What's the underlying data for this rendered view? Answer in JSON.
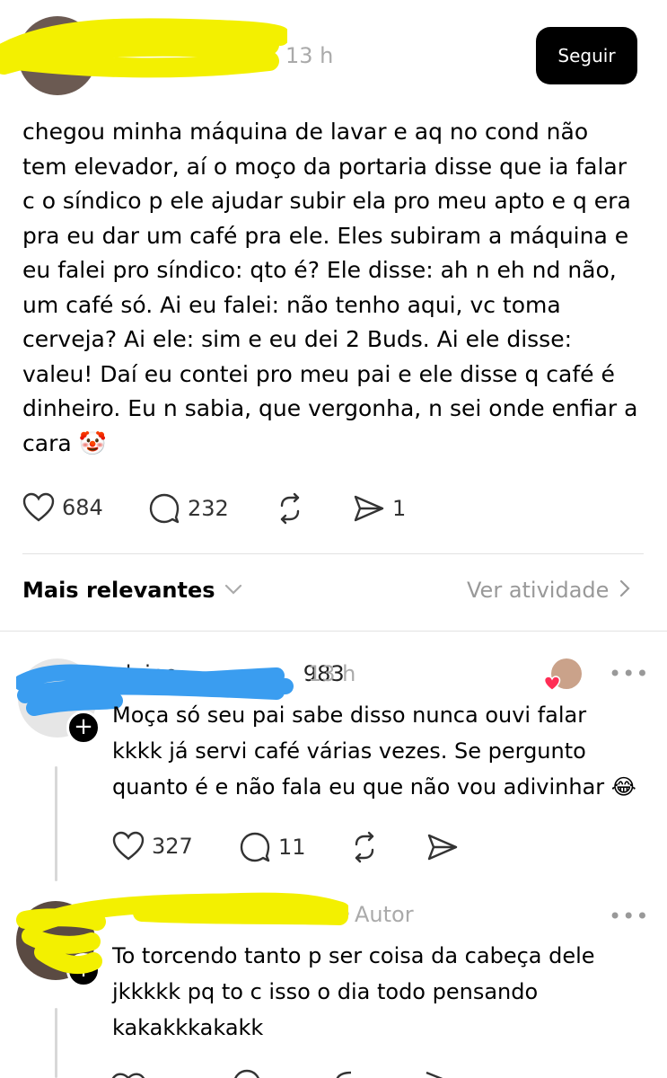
{
  "post": {
    "time": "13 h",
    "follow_label": "Seguir",
    "text": "chegou minha máquina de lavar e aq no cond não\ntem elevador, aí o moço da portaria disse que ia falar\nc o síndico p ele ajudar subir ela pro meu apto e q era\npra eu dar um café pra ele. Eles subiram a máquina e\neu falei pro síndico: qto é? Ele disse: ah n eh nd não,\num café só. Ai eu falei: não tenho aqui, vc toma\ncerveja? Ai ele: sim e eu dei 2 Buds. Ai ele disse:\nvaleu! Daí eu contei pro meu pai e ele disse q café é\ndinheiro. Eu n sabia, que vergonha, n sei onde enfiar a\ncara 🤡",
    "likes": "684",
    "comments": "232",
    "shares": "1"
  },
  "replies_header": {
    "sort_label": "Mais relevantes",
    "activity_label": "Ver atividade"
  },
  "replies": [
    {
      "username": "elaine",
      "username_suffix": "983",
      "time": "13 h",
      "text": "Moça só seu pai sabe disso nunca ouvi falar\nkkkk já servi café várias vezes. Se pergunto\nquanto é e não fala eu que não vou adivinhar 😂",
      "likes": "327",
      "comments": "11"
    },
    {
      "author_label": "Autor",
      "text": "To torcendo tanto p ser coisa da cabeça dele\njkkkkk pq to c isso o dia todo pensando\nkakakkkakakk"
    }
  ],
  "icons": {
    "like": "heart-icon",
    "comment": "comment-icon",
    "repost": "repost-icon",
    "share": "share-icon",
    "more": "more-icon",
    "chevron": "chevron-right-icon"
  },
  "colors": {
    "highlighter_yellow": "#f3f000",
    "highlighter_blue": "#3a9df0",
    "follow_bg": "#000000"
  }
}
